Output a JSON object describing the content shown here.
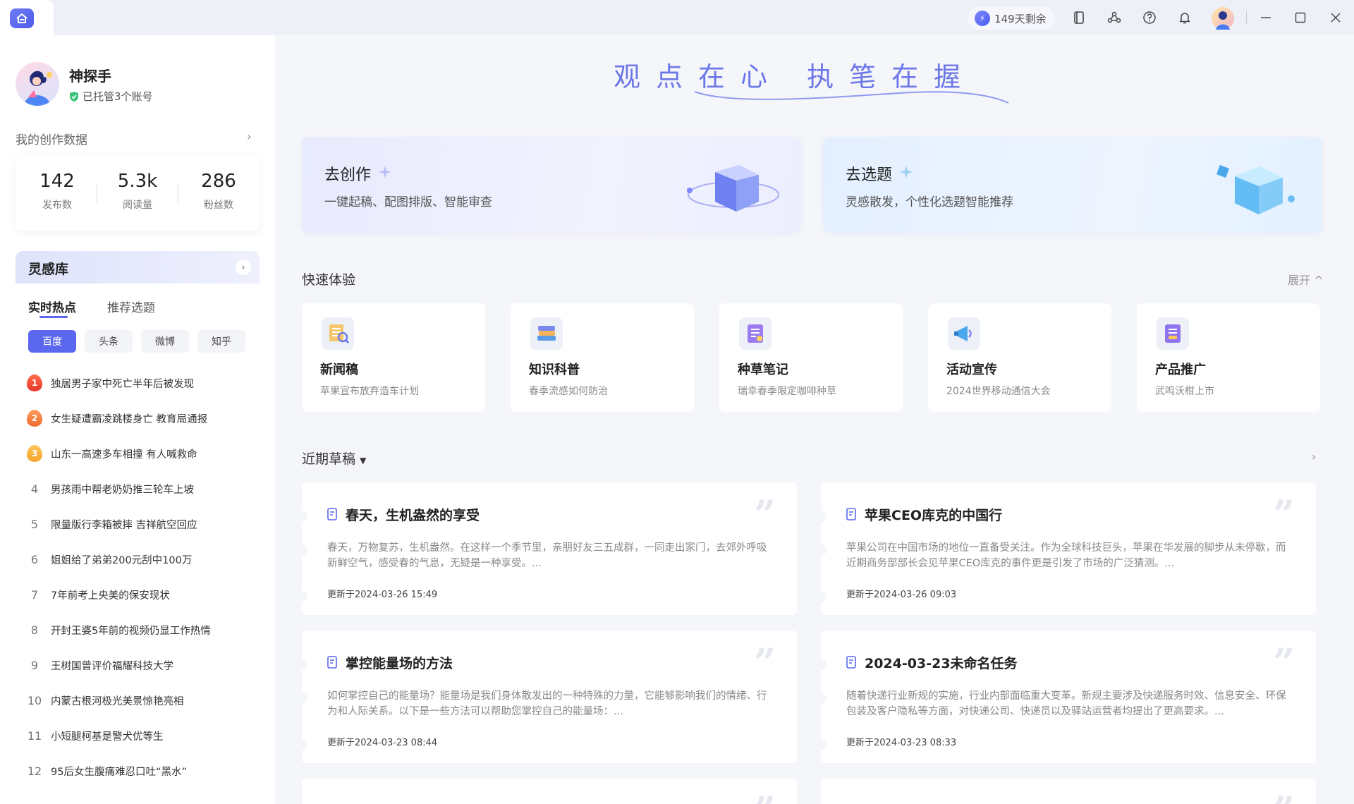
{
  "topbar": {
    "days_left": "149天剩余"
  },
  "profile": {
    "name": "神探手",
    "managed": "已托管3个账号"
  },
  "creation_stats": {
    "title": "我的创作数据",
    "items": [
      {
        "value": "142",
        "label": "发布数"
      },
      {
        "value": "5.3k",
        "label": "阅读量"
      },
      {
        "value": "286",
        "label": "粉丝数"
      }
    ]
  },
  "inspiration": {
    "title": "灵感库",
    "tabs": [
      "实时热点",
      "推荐选题"
    ],
    "sources": [
      "百度",
      "头条",
      "微博",
      "知乎"
    ],
    "hot_items": [
      {
        "rank": "1",
        "text": "独居男子家中死亡半年后被发现"
      },
      {
        "rank": "2",
        "text": "女生疑遭霸凌跳楼身亡 教育局通报"
      },
      {
        "rank": "3",
        "text": "山东一高速多车相撞 有人喊救命"
      },
      {
        "rank": "4",
        "text": "男孩雨中帮老奶奶推三轮车上坡"
      },
      {
        "rank": "5",
        "text": "限量版行李箱被摔 吉祥航空回应"
      },
      {
        "rank": "6",
        "text": "姐姐给了弟弟200元刮中100万"
      },
      {
        "rank": "7",
        "text": "7年前考上央美的保安现状"
      },
      {
        "rank": "8",
        "text": "开封王婆5年前的视频仍显工作热情"
      },
      {
        "rank": "9",
        "text": "王树国曾评价福耀科技大学"
      },
      {
        "rank": "10",
        "text": "内蒙古根河极光美景惊艳亮相"
      },
      {
        "rank": "11",
        "text": "小短腿柯基是警犬优等生"
      },
      {
        "rank": "12",
        "text": "95后女生腹痛难忍口吐“黑水”"
      }
    ]
  },
  "slogan": "观点在心 执笔在握",
  "big_cards": [
    {
      "title": "去创作",
      "subtitle": "一键起稿、配图排版、智能审查"
    },
    {
      "title": "去选题",
      "subtitle": "灵感散发，个性化选题智能推荐"
    }
  ],
  "quick": {
    "title": "快速体验",
    "expand": "展开",
    "items": [
      {
        "title": "新闻稿",
        "sub": "苹果宣布放弃造车计划",
        "icon": "newspaper-icon"
      },
      {
        "title": "知识科普",
        "sub": "春季流感如何防治",
        "icon": "books-icon"
      },
      {
        "title": "种草笔记",
        "sub": "瑞幸春季限定咖啡种草",
        "icon": "note-icon"
      },
      {
        "title": "活动宣传",
        "sub": "2024世界移动通信大会",
        "icon": "megaphone-icon"
      },
      {
        "title": "产品推广",
        "sub": "武鸣沃柑上市",
        "icon": "product-icon"
      }
    ]
  },
  "drafts": {
    "title": "近期草稿",
    "items": [
      {
        "title": "春天，生机盎然的享受",
        "text": "春天，万物复苏，生机盎然。在这样一个季节里，亲朋好友三五成群，一同走出家门，去郊外呼吸新鲜空气，感受春的气息，无疑是一种享受。...",
        "time": "更新于2024-03-26 15:49"
      },
      {
        "title": "苹果CEO库克的中国行",
        "text": "苹果公司在中国市场的地位一直备受关注。作为全球科技巨头，苹果在华发展的脚步从未停歇，而近期商务部部长会见苹果CEO库克的事件更是引发了市场的广泛猜测。...",
        "time": "更新于2024-03-26 09:03"
      },
      {
        "title": "掌控能量场的方法",
        "text": "如何掌控自己的能量场？能量场是我们身体散发出的一种特殊的力量，它能够影响我们的情绪、行为和人际关系。以下是一些方法可以帮助您掌控自己的能量场：...",
        "time": "更新于2024-03-23 08:44"
      },
      {
        "title": "2024-03-23未命名任务",
        "text": "随着快递行业新规的实施，行业内部面临重大变革。新规主要涉及快递服务时效、信息安全、环保包装及客户隐私等方面，对快递公司、快递员以及驿站运营者均提出了更高要求。...",
        "time": "更新于2024-03-23 08:33"
      }
    ]
  }
}
